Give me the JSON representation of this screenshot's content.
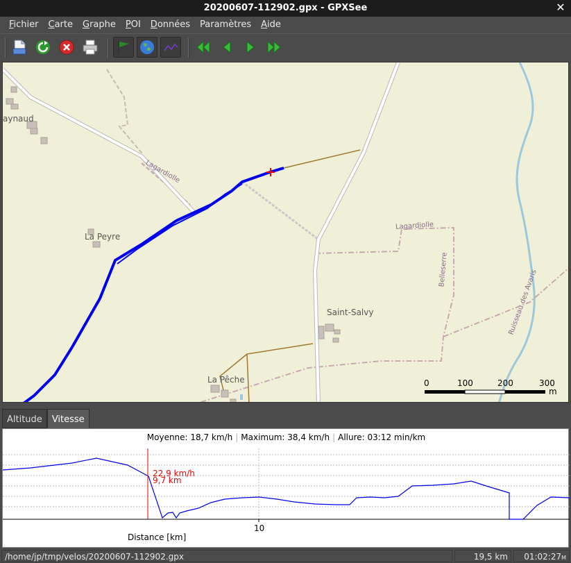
{
  "window": {
    "title": "20200607-112902.gpx - GPXSee",
    "close_label": "✕"
  },
  "menu": {
    "items": [
      {
        "first": "F",
        "rest": "ichier"
      },
      {
        "first": "C",
        "rest": "arte"
      },
      {
        "first": "G",
        "rest": "raphe"
      },
      {
        "first": "P",
        "rest": "OI"
      },
      {
        "first": "D",
        "rest": "onnées"
      },
      {
        "first": "",
        "rest": "Paramètres"
      },
      {
        "first": "A",
        "rest": "ide"
      }
    ]
  },
  "toolbar": {
    "buttons": [
      "open-icon",
      "reload-icon",
      "close-file-icon",
      "print-icon",
      "poi-flag-icon",
      "map-globe-icon",
      "graph-icon",
      "first-icon",
      "prev-icon",
      "next-icon",
      "last-icon"
    ]
  },
  "map": {
    "place_labels": [
      "aynaud",
      "La Peyre",
      "Saint-Salvy",
      "La Pêche"
    ],
    "road_labels": [
      "Lagardiolle",
      "Lagardiolle",
      "Belleserre",
      "Ruisseau des Avaris"
    ],
    "scale": {
      "ticks": [
        "0",
        "100",
        "200",
        "300"
      ],
      "unit": "m"
    },
    "colors": {
      "track": "#0000ee",
      "background": "#f0f0d8",
      "road": "#ffffff",
      "river": "#9cc8dc",
      "track_alt": "#a07830"
    }
  },
  "tabs": [
    {
      "label": "Altitude",
      "active": false
    },
    {
      "label": "Vitesse",
      "active": true
    }
  ],
  "graph": {
    "stats": {
      "moyenne": "Moyenne: 18,7 km/h",
      "maximum": "Maximum: 38,4 km/h",
      "allure": "Allure: 03:12 min/km"
    },
    "marker_speed": "22,9 km/h",
    "marker_distance": "9,7 km",
    "x_tick": "10",
    "x_label": "Distance [km]",
    "colors": {
      "line": "#0000ee",
      "marker": "#ee0000"
    }
  },
  "status": {
    "path": "/home/jp/tmp/velos/20200607-112902.gpx",
    "distance": "19,5 km",
    "time": "01:02:27",
    "time_unit": "M"
  }
}
